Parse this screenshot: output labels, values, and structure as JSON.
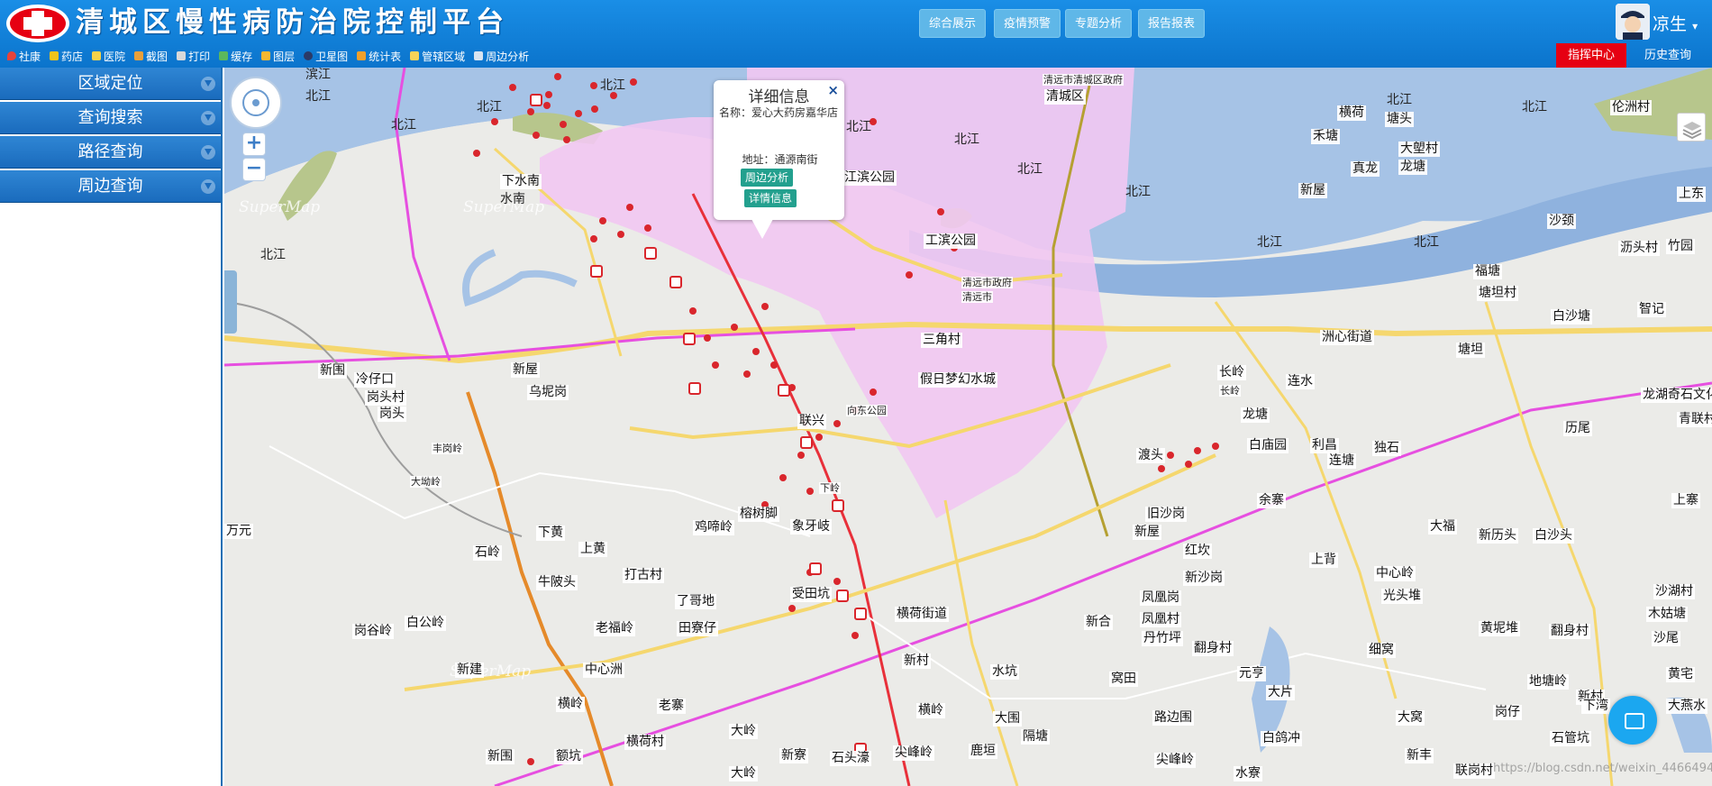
{
  "header": {
    "title": "清城区慢性病防治院控制平台",
    "nav": [
      "综合展示",
      "疫情预警",
      "专题分析",
      "报告报表"
    ],
    "user_name": "凉生",
    "user_caret": "▾",
    "toolbar": [
      {
        "label": "社康",
        "color": "#e8433a"
      },
      {
        "label": "药店",
        "color": "#f0c419"
      },
      {
        "label": "医院",
        "color": "#f6d24a"
      },
      {
        "label": "截图",
        "color": "#e9a03a"
      },
      {
        "label": "打印",
        "color": "#d9d9d9"
      },
      {
        "label": "缓存",
        "color": "#5cb85c"
      },
      {
        "label": "图层",
        "color": "#f7b731"
      },
      {
        "label": "卫星图",
        "color": "#2b3a67"
      },
      {
        "label": "统计表",
        "color": "#f0a02b"
      },
      {
        "label": "管辖区域",
        "color": "#f7d358"
      },
      {
        "label": "周边分析",
        "color": "#d9e4f0"
      }
    ],
    "command_center": "指挥中心",
    "history_query": "历史查询"
  },
  "sidebar": {
    "items": [
      "区域定位",
      "查询搜索",
      "路径查询",
      "周边查询"
    ]
  },
  "map": {
    "watermark": "SuperMap",
    "url_watermark": "https://blog.csdn.net/weixin_44664948",
    "zoom_in": "+",
    "zoom_out": "−",
    "popup": {
      "title": "详细信息",
      "close": "×",
      "name_line": "名称：爱心大药房嘉华店",
      "address_line": "地址：通源南街",
      "btn_nearby": "周边分析",
      "btn_detail": "详情信息"
    },
    "place_labels": [
      "滨江",
      "北江",
      "北江",
      "北江",
      "北江",
      "北江",
      "北江",
      "北江",
      "北江",
      "北江",
      "北江",
      "北江",
      "北江",
      "北江",
      "北江",
      "清远市清城区政府",
      "清城区",
      "横荷",
      "禾塘",
      "塘头",
      "大塱村",
      "龙塘",
      "真龙",
      "新屋",
      "伦洲村",
      "上东",
      "沙颈",
      "沥头村",
      "竹园",
      "福塘",
      "塘坦村",
      "白沙塘",
      "智记",
      "下水南",
      "水南",
      "江滨公园",
      "工滨公园",
      "清远市政府",
      "清远市",
      "三角村",
      "假日梦幻水城",
      "洲心街道",
      "塘坦",
      "长岭",
      "连水",
      "龙塘",
      "白庙园",
      "利昌",
      "连塘",
      "独石",
      "龙湖奇石文化",
      "历尾",
      "青联村",
      "新围",
      "冷仔口",
      "岗头村",
      "岗头",
      "新屋",
      "乌坭岗",
      "向东公园",
      "联兴",
      "渡头",
      "旧沙岗",
      "余寨",
      "新屋",
      "红坎",
      "新沙岗",
      "上背",
      "中心岭",
      "光头堆",
      "大福",
      "新历头",
      "白沙头",
      "上寨",
      "万元",
      "石岭",
      "下黄",
      "上黄",
      "牛陂头",
      "打古村",
      "鸡啼岭",
      "榕树脚",
      "象牙岐",
      "了哥地",
      "受田坑",
      "田寮仔",
      "老福岭",
      "中心洲",
      "横岭",
      "老寨",
      "新建",
      "岗谷岭",
      "白公岭",
      "横荷街道",
      "新村",
      "凤凰岗",
      "凤凰村",
      "丹竹坪",
      "翻身村",
      "新合",
      "沙湖村",
      "木姑塘",
      "黄坭堆",
      "翻身村",
      "细窝",
      "沙尾",
      "地塘岭",
      "新村",
      "黄宅",
      "下湾",
      "大燕水",
      "水坑",
      "元亨",
      "大片",
      "窝田",
      "路边围",
      "横岭",
      "大围",
      "隔塘",
      "鹿垣",
      "大窝",
      "岗仔",
      "石管坑",
      "白鸽冲",
      "新丰",
      "联岗村",
      "大岭",
      "新寮",
      "石头濠",
      "尖峰岭",
      "尖峰岭",
      "横荷村",
      "额坑",
      "新围",
      "水寮",
      "大岭"
    ],
    "small_labels": [
      "丰岗岭",
      "大坳岭",
      "下岭",
      "长岭"
    ]
  }
}
